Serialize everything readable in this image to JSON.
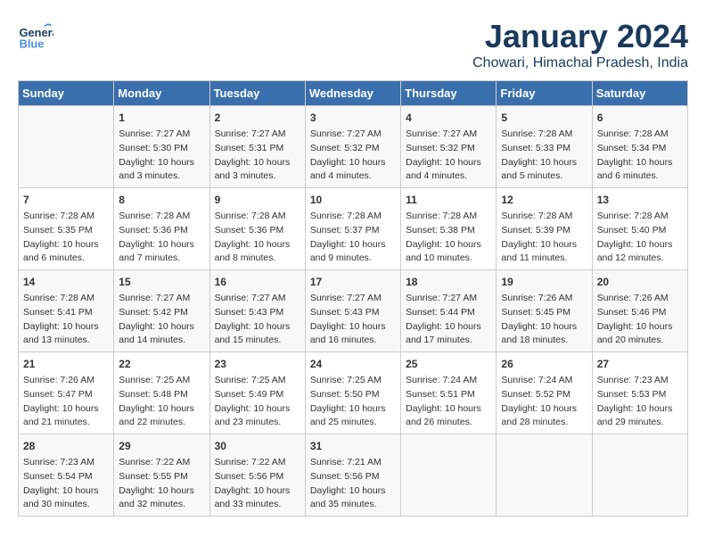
{
  "header": {
    "logo_general": "General",
    "logo_blue": "Blue",
    "month": "January 2024",
    "location": "Chowari, Himachal Pradesh, India"
  },
  "days_of_week": [
    "Sunday",
    "Monday",
    "Tuesday",
    "Wednesday",
    "Thursday",
    "Friday",
    "Saturday"
  ],
  "weeks": [
    [
      {
        "day": "",
        "data": ""
      },
      {
        "day": "1",
        "data": "Sunrise: 7:27 AM\nSunset: 5:30 PM\nDaylight: 10 hours\nand 3 minutes."
      },
      {
        "day": "2",
        "data": "Sunrise: 7:27 AM\nSunset: 5:31 PM\nDaylight: 10 hours\nand 3 minutes."
      },
      {
        "day": "3",
        "data": "Sunrise: 7:27 AM\nSunset: 5:32 PM\nDaylight: 10 hours\nand 4 minutes."
      },
      {
        "day": "4",
        "data": "Sunrise: 7:27 AM\nSunset: 5:32 PM\nDaylight: 10 hours\nand 4 minutes."
      },
      {
        "day": "5",
        "data": "Sunrise: 7:28 AM\nSunset: 5:33 PM\nDaylight: 10 hours\nand 5 minutes."
      },
      {
        "day": "6",
        "data": "Sunrise: 7:28 AM\nSunset: 5:34 PM\nDaylight: 10 hours\nand 6 minutes."
      }
    ],
    [
      {
        "day": "7",
        "data": "Sunrise: 7:28 AM\nSunset: 5:35 PM\nDaylight: 10 hours\nand 6 minutes."
      },
      {
        "day": "8",
        "data": "Sunrise: 7:28 AM\nSunset: 5:36 PM\nDaylight: 10 hours\nand 7 minutes."
      },
      {
        "day": "9",
        "data": "Sunrise: 7:28 AM\nSunset: 5:36 PM\nDaylight: 10 hours\nand 8 minutes."
      },
      {
        "day": "10",
        "data": "Sunrise: 7:28 AM\nSunset: 5:37 PM\nDaylight: 10 hours\nand 9 minutes."
      },
      {
        "day": "11",
        "data": "Sunrise: 7:28 AM\nSunset: 5:38 PM\nDaylight: 10 hours\nand 10 minutes."
      },
      {
        "day": "12",
        "data": "Sunrise: 7:28 AM\nSunset: 5:39 PM\nDaylight: 10 hours\nand 11 minutes."
      },
      {
        "day": "13",
        "data": "Sunrise: 7:28 AM\nSunset: 5:40 PM\nDaylight: 10 hours\nand 12 minutes."
      }
    ],
    [
      {
        "day": "14",
        "data": "Sunrise: 7:28 AM\nSunset: 5:41 PM\nDaylight: 10 hours\nand 13 minutes."
      },
      {
        "day": "15",
        "data": "Sunrise: 7:27 AM\nSunset: 5:42 PM\nDaylight: 10 hours\nand 14 minutes."
      },
      {
        "day": "16",
        "data": "Sunrise: 7:27 AM\nSunset: 5:43 PM\nDaylight: 10 hours\nand 15 minutes."
      },
      {
        "day": "17",
        "data": "Sunrise: 7:27 AM\nSunset: 5:43 PM\nDaylight: 10 hours\nand 16 minutes."
      },
      {
        "day": "18",
        "data": "Sunrise: 7:27 AM\nSunset: 5:44 PM\nDaylight: 10 hours\nand 17 minutes."
      },
      {
        "day": "19",
        "data": "Sunrise: 7:26 AM\nSunset: 5:45 PM\nDaylight: 10 hours\nand 18 minutes."
      },
      {
        "day": "20",
        "data": "Sunrise: 7:26 AM\nSunset: 5:46 PM\nDaylight: 10 hours\nand 20 minutes."
      }
    ],
    [
      {
        "day": "21",
        "data": "Sunrise: 7:26 AM\nSunset: 5:47 PM\nDaylight: 10 hours\nand 21 minutes."
      },
      {
        "day": "22",
        "data": "Sunrise: 7:25 AM\nSunset: 5:48 PM\nDaylight: 10 hours\nand 22 minutes."
      },
      {
        "day": "23",
        "data": "Sunrise: 7:25 AM\nSunset: 5:49 PM\nDaylight: 10 hours\nand 23 minutes."
      },
      {
        "day": "24",
        "data": "Sunrise: 7:25 AM\nSunset: 5:50 PM\nDaylight: 10 hours\nand 25 minutes."
      },
      {
        "day": "25",
        "data": "Sunrise: 7:24 AM\nSunset: 5:51 PM\nDaylight: 10 hours\nand 26 minutes."
      },
      {
        "day": "26",
        "data": "Sunrise: 7:24 AM\nSunset: 5:52 PM\nDaylight: 10 hours\nand 28 minutes."
      },
      {
        "day": "27",
        "data": "Sunrise: 7:23 AM\nSunset: 5:53 PM\nDaylight: 10 hours\nand 29 minutes."
      }
    ],
    [
      {
        "day": "28",
        "data": "Sunrise: 7:23 AM\nSunset: 5:54 PM\nDaylight: 10 hours\nand 30 minutes."
      },
      {
        "day": "29",
        "data": "Sunrise: 7:22 AM\nSunset: 5:55 PM\nDaylight: 10 hours\nand 32 minutes."
      },
      {
        "day": "30",
        "data": "Sunrise: 7:22 AM\nSunset: 5:56 PM\nDaylight: 10 hours\nand 33 minutes."
      },
      {
        "day": "31",
        "data": "Sunrise: 7:21 AM\nSunset: 5:56 PM\nDaylight: 10 hours\nand 35 minutes."
      },
      {
        "day": "",
        "data": ""
      },
      {
        "day": "",
        "data": ""
      },
      {
        "day": "",
        "data": ""
      }
    ]
  ]
}
